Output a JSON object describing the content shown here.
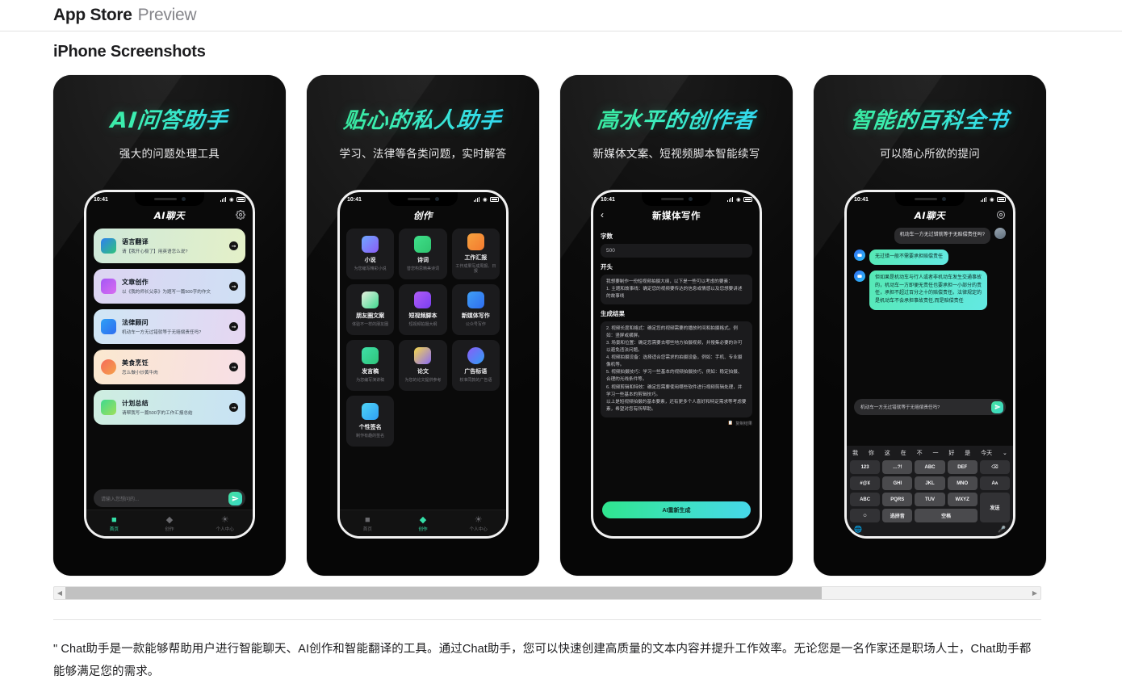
{
  "topbar": {
    "brand": "App Store",
    "preview": "Preview"
  },
  "section": {
    "title": "iPhone Screenshots"
  },
  "scrollbar": {
    "left_arrow": "◀",
    "right_arrow": "▶",
    "thumb_percent": 78.5
  },
  "description": "\" Chat助手是一款能够帮助用户进行智能聊天、AI创作和智能翻译的工具。通过Chat助手，您可以快速创建高质量的文本内容并提升工作效率。无论您是一名作家还是职场人士，Chat助手都能够满足您的需求。",
  "colors": {
    "accent_green": "#35e08a",
    "accent_cyan": "#2fd0ff",
    "bubble_ai": "#56e9b4"
  },
  "shots": [
    {
      "title": "AI问答助手",
      "subtitle": "强大的问题处理工具",
      "status_time": "10:41",
      "app_title": "AI聊天",
      "input_placeholder": "请输入您想问的...",
      "cards": [
        {
          "title": "语言翻译",
          "desc": "请【我开心极了】用英语怎么说?",
          "icon": "translate-icon"
        },
        {
          "title": "文章创作",
          "desc": "以《我的师长父亲》为题写一篇500字的作文",
          "icon": "pen-icon"
        },
        {
          "title": "法律顾问",
          "desc": "机动车一方无过错就等于无赔偿责任吗?",
          "icon": "law-icon"
        },
        {
          "title": "美食烹饪",
          "desc": "怎么做小炒黄牛肉",
          "icon": "food-icon"
        },
        {
          "title": "计划总结",
          "desc": "请帮我写一篇500字的工作汇报总结",
          "icon": "plan-icon"
        }
      ],
      "tabs": [
        {
          "label": "首页",
          "icon": "home-icon",
          "active": true
        },
        {
          "label": "创作",
          "icon": "create-icon",
          "active": false
        },
        {
          "label": "个人中心",
          "icon": "profile-icon",
          "active": false
        }
      ]
    },
    {
      "title": "贴心的私人助手",
      "subtitle": "学习、法律等各类问题，实时解答",
      "status_time": "10:41",
      "app_title": "创作",
      "grid": [
        {
          "title": "小说",
          "desc": "为您编写精彩小说",
          "icon": "novel-icon"
        },
        {
          "title": "诗词",
          "desc": "替您构思精美诗词",
          "icon": "poem-icon"
        },
        {
          "title": "工作汇报",
          "desc": "工作成果写成周报、日报",
          "icon": "report-icon"
        },
        {
          "title": "朋友圈文案",
          "desc": "体验不一样的朋友圈",
          "icon": "moments-icon"
        },
        {
          "title": "短视频脚本",
          "desc": "短视频拍摄大纲",
          "icon": "video-icon"
        },
        {
          "title": "新媒体写作",
          "desc": "公众号写作",
          "icon": "media-icon"
        },
        {
          "title": "发言稿",
          "desc": "为您编写演讲稿",
          "icon": "speech-icon"
        },
        {
          "title": "论文",
          "desc": "为您的论文提供参考",
          "icon": "thesis-icon"
        },
        {
          "title": "广告标语",
          "desc": "校准同款的广告语",
          "icon": "ad-icon"
        },
        {
          "title": "个性签名",
          "desc": "制作有趣的签名",
          "icon": "sign-icon"
        }
      ],
      "tabs": [
        {
          "label": "首页",
          "icon": "home-icon",
          "active": false
        },
        {
          "label": "创作",
          "icon": "create-icon",
          "active": true
        },
        {
          "label": "个人中心",
          "icon": "profile-icon",
          "active": false
        }
      ]
    },
    {
      "title": "高水平的创作者",
      "subtitle": "新媒体文案、短视频脚本智能续写",
      "status_time": "10:41",
      "app_title": "新媒体写作",
      "label_count": "字数",
      "value_count": "500",
      "label_intro": "开头",
      "intro_text": "我想要制作一份短视频拍摄大纲，以下是一些可以考虑的要素：\n1. 主题和故事线：确定您的视频要传达的信息或情感以及您想要讲述的故事线",
      "label_result": "生成结果",
      "result_text": "2. 视频长度和格式：确定您的视频需要的播放时间和拍摄格式。例如：竖屏或横屏。\n3. 场景和位置：确定您需要去哪些地方拍摄视频，并搜集必要的许可以避免违法问题。\n4. 视频拍摄设备：选择适合您需求的拍摄设备，例如：手机、专业摄像机等。\n5. 视频拍摄技巧：学习一些基本的视频拍摄技巧，例如：稳定拍摄、合理的光线条件等。\n6. 视频剪辑和特效：确定您需要使用哪些软件进行视频剪辑处理，并学习一些基本的剪辑技巧。\n以上是短视频拍摄的基本要素，还有更多个人喜好和特定需求等考虑要素，希望对您有所帮助。",
      "copy_label": "复制结果",
      "regen_label": "AI重新生成"
    },
    {
      "title": "智能的百科全书",
      "subtitle": "可以随心所欲的提问",
      "status_time": "10:41",
      "app_title": "AI聊天",
      "messages": [
        {
          "from": "user",
          "text": "机动车一方无过错就等于无赔偿责任吗?"
        },
        {
          "from": "ai",
          "text": "无过错一般不需要承担赔偿责任"
        },
        {
          "from": "ai",
          "text": "但如果是机动车与行人或者非机动车发生交通事故的，机动车一方即便无责任也要承担一小部分的责任，承担不超过百分之十的赔偿责任。法律规定的是机动车不会承担事故责任,而是赔偿责任"
        }
      ],
      "chat_input_value": "机动车一方无过错就等于无赔偿责任吗?",
      "suggestions": [
        "我",
        "你",
        "这",
        "在",
        "不",
        "一",
        "好",
        "是",
        "今天"
      ],
      "suggestion_more": "⌄",
      "keyboard": [
        "123",
        "…?!",
        "ABC",
        "DEF",
        "⌫",
        "#@¥",
        "GHI",
        "JKL",
        "MNO",
        "Aᴀ",
        "ABC",
        "PQRS",
        "TUV",
        "WXYZ",
        "发送",
        "☺",
        "选拼音",
        "空格"
      ],
      "kb_globe": "globe-icon",
      "kb_mic": "mic-icon"
    }
  ]
}
